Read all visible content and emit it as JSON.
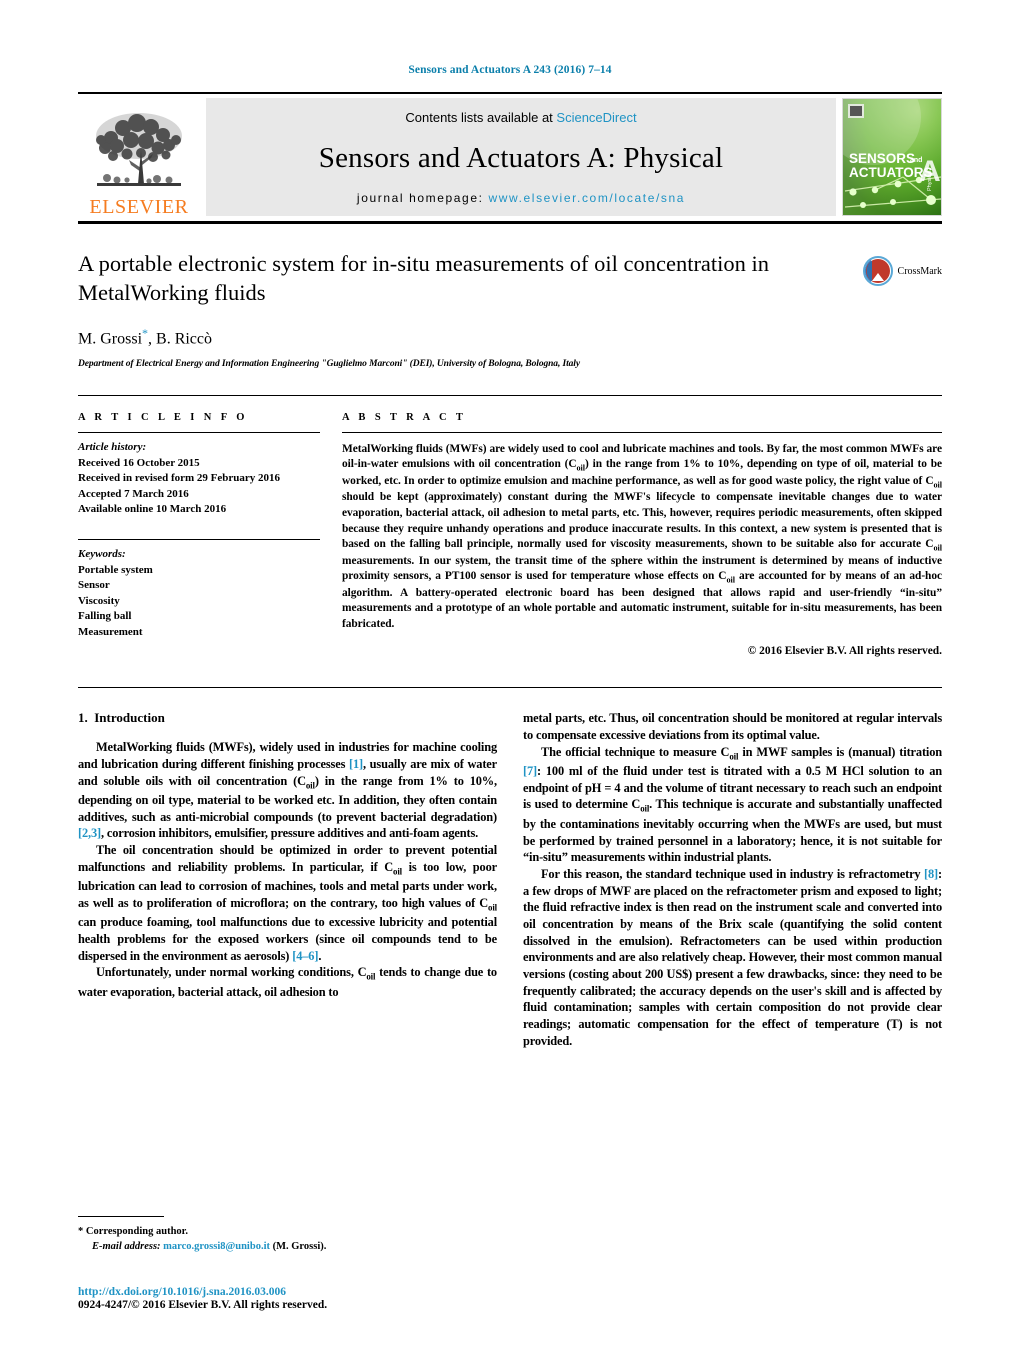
{
  "running_head": "Sensors and Actuators A 243 (2016) 7–14",
  "masthead": {
    "publisher_logo_text": "ELSEVIER",
    "contents_prefix": "Contents lists available at ",
    "contents_link": "ScienceDirect",
    "journal_title": "Sensors and Actuators A: Physical",
    "homepage_prefix": "journal homepage: ",
    "homepage_url": "www.elsevier.com/locate/sna",
    "cover": {
      "line1": "SENSORS",
      "and": "and",
      "line2": "ACTUATORS",
      "big_letter": "A",
      "subtitle": "Physical"
    }
  },
  "article": {
    "title": "A portable electronic system for in-situ measurements of oil concentration in MetalWorking fluids",
    "authors": "M. Grossi",
    "author_star": "*",
    "authors_rest": ", B. Riccò",
    "affiliation": "Department of Electrical Energy and Information Engineering \"Guglielmo Marconi\" (DEI), University of Bologna, Bologna, Italy",
    "crossmark_label": "CrossMark"
  },
  "article_info": {
    "heading": "A R T I C L E   I N F O",
    "history_label": "Article history:",
    "history": [
      "Received 16 October 2015",
      "Received in revised form 29 February 2016",
      "Accepted 7 March 2016",
      "Available online 10 March 2016"
    ],
    "keywords_label": "Keywords:",
    "keywords": [
      "Portable system",
      "Sensor",
      "Viscosity",
      "Falling ball",
      "Measurement"
    ]
  },
  "abstract": {
    "heading": "A B S T R A C T",
    "p1_a": "MetalWorking fluids (MWFs) are widely used to cool and lubricate machines and tools. By far, the most common MWFs are oil-in-water emulsions with oil concentration (C",
    "p1_sub1": "oil",
    "p1_b": ") in the range from 1% to 10%, depending on type of oil, material to be worked, etc. In order to optimize emulsion and machine performance, as well as for good waste policy, the right value of C",
    "p1_sub2": "oil",
    "p1_c": " should be kept (approximately) constant during the MWF's lifecycle to compensate inevitable changes due to water evaporation, bacterial attack, oil adhesion to metal parts, etc. This, however, requires periodic measurements, often skipped because they require unhandy operations and produce inaccurate results. In this context, a new system is presented that is based on the falling ball principle, normally used for viscosity measurements, shown to be suitable also for accurate C",
    "p1_sub3": "oil",
    "p1_d": " measurements. In our system, the transit time of the sphere within the instrument is determined by means of inductive proximity sensors, a PT100 sensor is used for temperature whose effects on C",
    "p1_sub4": "oil",
    "p1_e": " are accounted for by means of an ad-hoc algorithm. A battery-operated electronic board has been designed that allows rapid and user-friendly “in-situ” measurements and a prototype of an whole portable and automatic instrument, suitable for in-situ measurements, has been fabricated.",
    "copyright": "© 2016 Elsevier B.V. All rights reserved."
  },
  "introduction": {
    "section_number": "1.",
    "section_title": "Introduction",
    "left": {
      "p1_a": "MetalWorking fluids (MWFs), widely used in industries for machine cooling and lubrication during different finishing processes ",
      "p1_ref1": "[1]",
      "p1_b": ", usually are mix of water and soluble oils with oil concentration (C",
      "p1_sub1": "oil",
      "p1_c": ") in the range from 1% to 10%, depending on oil type, material to be worked etc. In addition, they often contain additives, such as anti-microbial compounds (to prevent bacterial degradation) ",
      "p1_ref2": "[2,3]",
      "p1_d": ", corrosion inhibitors, emulsifier, pressure additives and anti-foam agents.",
      "p2_a": "The oil concentration should be optimized in order to prevent potential malfunctions and reliability problems. In particular, if C",
      "p2_sub1": "oil",
      "p2_b": " is too low, poor lubrication can lead to corrosion of machines, tools and metal parts under work, as well as to proliferation of microflora; on the contrary, too high values of C",
      "p2_sub2": "oil",
      "p2_c": " can produce foaming, tool malfunctions due to excessive lubricity and potential health problems for the exposed workers (since oil compounds tend to be dispersed in the environment as aerosols) ",
      "p2_ref1": "[4–6]",
      "p2_d": ".",
      "p3_a": "Unfortunately, under normal working conditions, C",
      "p3_sub1": "oil",
      "p3_b": " tends to change due to water evaporation, bacterial attack, oil adhesion to"
    },
    "right": {
      "p3_cont": "metal parts, etc. Thus, oil concentration should be monitored at regular intervals to compensate excessive deviations from its optimal value.",
      "p4_a": "The official technique to measure C",
      "p4_sub1": "oil",
      "p4_b": " in MWF samples is (manual) titration ",
      "p4_ref1": "[7]",
      "p4_c": ": 100 ml of the fluid under test is titrated with a 0.5 M HCl solution to an endpoint of pH = 4 and the volume of titrant necessary to reach such an endpoint is used to determine C",
      "p4_sub2": "oil",
      "p4_d": ". This technique is accurate and substantially unaffected by the contaminations inevitably occurring when the MWFs are used, but must be performed by trained personnel in a laboratory; hence, it is not suitable for “in-situ” measurements within industrial plants.",
      "p5_a": "For this reason, the standard technique used in industry is refractometry ",
      "p5_ref1": "[8]",
      "p5_b": ": a few drops of MWF are placed on the refractometer prism and exposed to light; the fluid refractive index is then read on the instrument scale and converted into oil concentration by means of the Brix scale (quantifying the solid content dissolved in the emulsion). Refractometers can be used within production environments and are also relatively cheap. However, their most common manual versions (costing about 200 US$) present a few drawbacks, since: they need to be frequently calibrated; the accuracy depends on the user's skill and is affected by fluid contamination; samples with certain composition do not provide clear readings; automatic compensation for the effect of temperature (T) is not provided."
    }
  },
  "footer": {
    "corresponding_marker": "*",
    "corresponding_label": "Corresponding author.",
    "email_label": "E-mail address:",
    "email": "marco.grossi8@unibo.it",
    "email_suffix": "(M. Grossi).",
    "doi": "http://dx.doi.org/10.1016/j.sna.2016.03.006",
    "issn_line": "0924-4247/© 2016 Elsevier B.V. All rights reserved."
  },
  "colors": {
    "link": "#1f93c4",
    "running_head": "#0b7fab",
    "elsevier_orange": "#f57c20",
    "cover_green": "#6fbd3d"
  }
}
